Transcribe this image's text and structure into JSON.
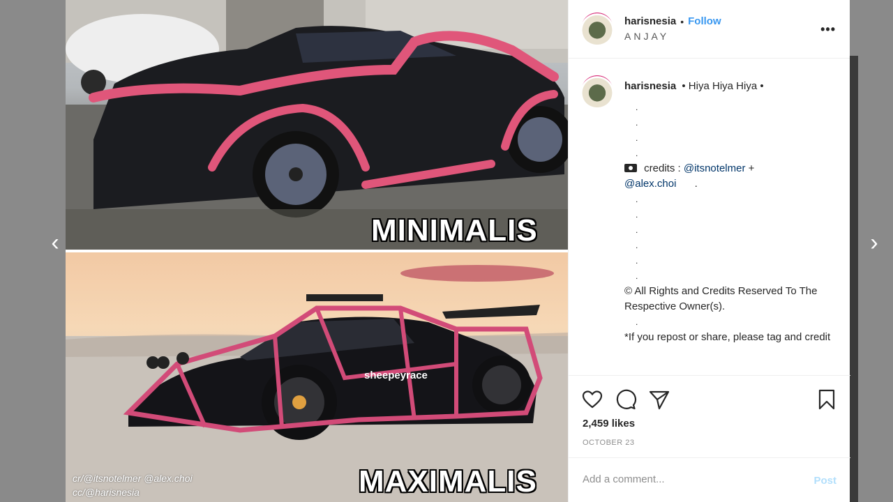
{
  "navigation": {
    "prev_arrow": "‹",
    "next_arrow": "›"
  },
  "media": {
    "top_caption": "MINIMALIS",
    "bottom_caption": "MAXIMALIS",
    "watermark_line1": "cr/@itsnotelmer @alex.choi",
    "watermark_line2": "cc/@harisnesia",
    "door_decal": "sheepeyrace"
  },
  "header": {
    "username": "harisnesia",
    "separator": "•",
    "follow_label": "Follow",
    "location": "ANJAY",
    "more_icon": "more-options-icon"
  },
  "caption": {
    "username": "harisnesia",
    "first_line": "• Hiya Hiya Hiya •",
    "dot": ".",
    "credits_label": "credits :",
    "credits_mention_1": "@itsnotelmer",
    "credits_plus": "+",
    "credits_mention_2": "@alex.choi",
    "rights_text": "© All Rights and Credits Reserved To The Respective Owner(s).",
    "repost_text": "*If you repost or share, please tag and credit"
  },
  "actions": {
    "likes": "2,459 likes",
    "date": "OCTOBER 23",
    "icons": [
      "heart-icon",
      "comment-icon",
      "share-icon",
      "bookmark-icon"
    ]
  },
  "comment": {
    "placeholder": "Add a comment...",
    "post_label": "Post"
  },
  "colors": {
    "follow": "#3897f0",
    "post_disabled": "#b2dffc",
    "pink_bars": "#e0567a"
  }
}
